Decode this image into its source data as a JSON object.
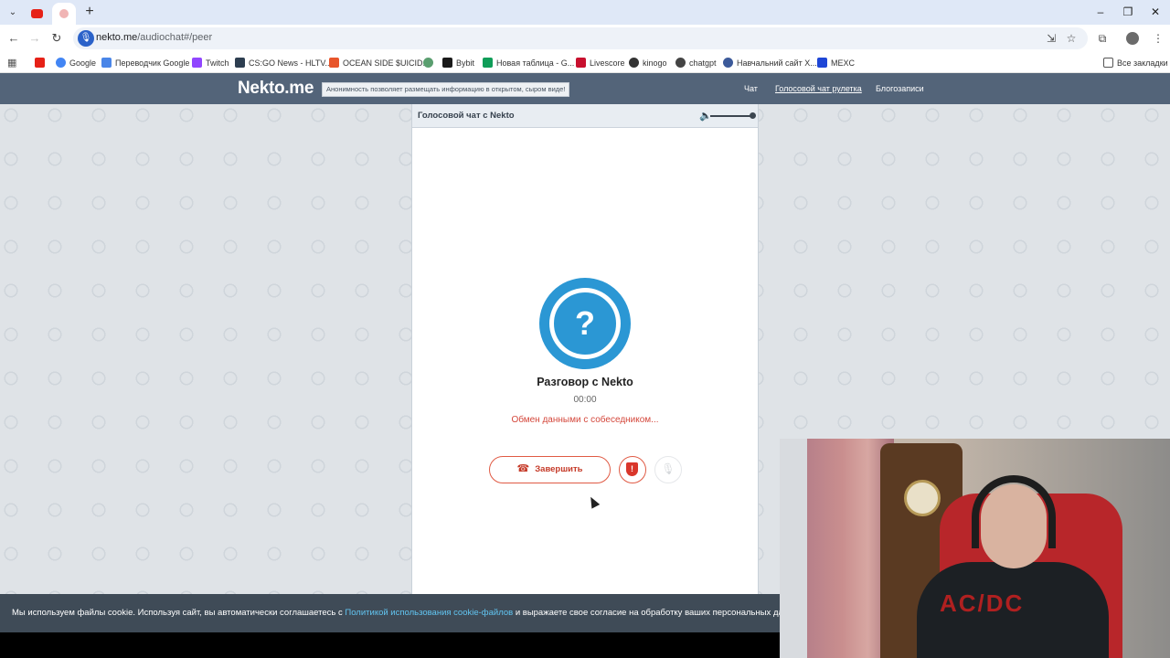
{
  "browser": {
    "url_host": "nekto.me",
    "url_path": "/audiochat#/peer",
    "bookmarks": [
      {
        "label": "",
        "color": "#e62117"
      },
      {
        "label": "Google",
        "color": "#4285f4"
      },
      {
        "label": "Переводчик Google",
        "color": "#4a86e8"
      },
      {
        "label": "Twitch",
        "color": "#9146ff"
      },
      {
        "label": "CS:GO News - HLTV...",
        "color": "#2d3e50"
      },
      {
        "label": "OCEAN SIDE $UICID...",
        "color": "#e8552b"
      },
      {
        "label": "",
        "color": "#5a9e6f"
      },
      {
        "label": "Bybit",
        "color": "#1a1a1a"
      },
      {
        "label": "Новая таблица - G...",
        "color": "#0f9d58"
      },
      {
        "label": "Livescore",
        "color": "#c8102e"
      },
      {
        "label": "kinogo",
        "color": "#333333"
      },
      {
        "label": "chatgpt",
        "color": "#444444"
      },
      {
        "label": "Навчальний сайт Х...",
        "color": "#3c5a9a"
      },
      {
        "label": "MEXC",
        "color": "#1e46d6"
      }
    ],
    "all_bookmarks": "Все закладки"
  },
  "site": {
    "logo": "Nekto.me",
    "tagline": "Анонимность позволяет размещать информацию в открытом, сыром виде!",
    "nav": [
      "Чат",
      "Голосовой чат рулетка",
      "Блогозаписи"
    ]
  },
  "chat": {
    "panel_title": "Голосовой чат с Nekto",
    "avatar_symbol": "?",
    "title": "Разговор с Nekto",
    "timer": "00:00",
    "status": "Обмен данными с собеседником...",
    "end_label": "Завершить",
    "volume_level": 1.0
  },
  "cookie": {
    "before": "Мы используем файлы cookie. Используя сайт, вы автоматически соглашаетесь с ",
    "link": "Политикой использования cookie-файлов",
    "after": " и выражаете свое согласие на обработку ваших персональных данн"
  },
  "webcam": {
    "shirt_logo": "AC/DC"
  }
}
